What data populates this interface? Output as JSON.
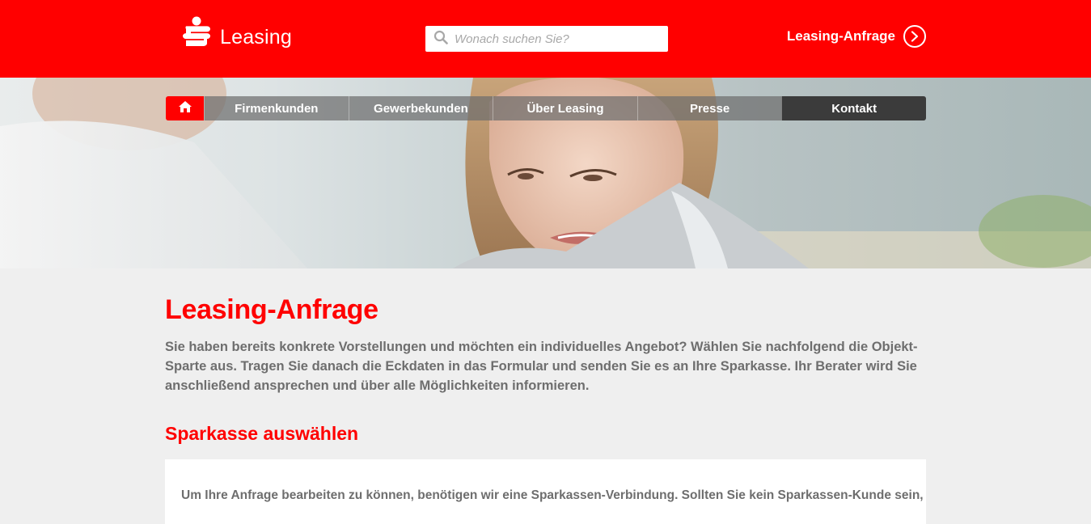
{
  "header": {
    "logo_text": "Leasing",
    "search_placeholder": "Wonach suchen Sie?",
    "cta_label": "Leasing-Anfrage"
  },
  "nav": {
    "items": [
      "Firmenkunden",
      "Gewerbekunden",
      "Über Leasing",
      "Presse",
      "Kontakt"
    ],
    "active": "Kontakt"
  },
  "main": {
    "title": "Leasing-Anfrage",
    "intro": "Sie haben bereits konkrete Vorstellungen und möchten ein individuelles Angebot? Wählen Sie nachfolgend die Objekt-Sparte aus. Tragen Sie danach die Eckdaten in das Formular und senden Sie es an Ihre Sparkasse. Ihr Berater wird Sie anschließend ansprechen und über alle Möglichkeiten informieren.",
    "section_title": "Sparkasse auswählen",
    "card_text": "Um Ihre Anfrage bearbeiten zu können, benötigen wir eine Sparkassen-Verbindung. Sollten Sie kein Sparkassen-Kunde sein,"
  },
  "colors": {
    "brand_red": "#ff0000",
    "nav_active": "#3b3b3b",
    "text_gray": "#6e6e6e",
    "page_bg": "#efefef"
  },
  "icons": {
    "logo": "sparkasse-s-icon",
    "search": "search-icon",
    "cta": "chevron-right-circle-icon",
    "home": "home-icon"
  }
}
